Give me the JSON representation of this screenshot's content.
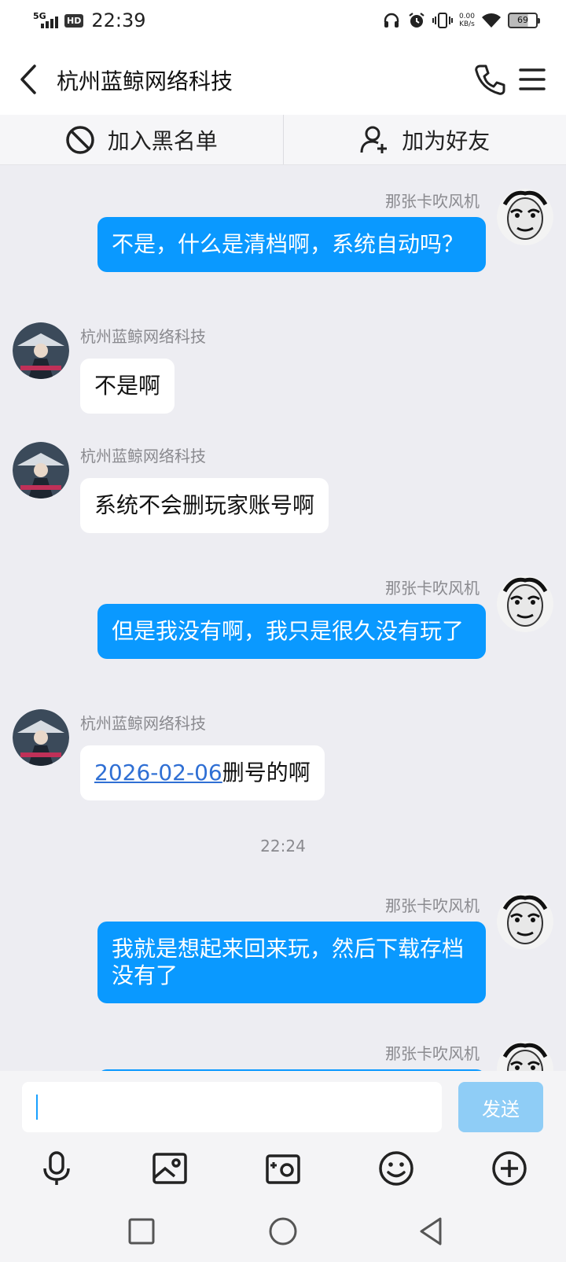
{
  "status_bar": {
    "network": "5G",
    "hd_badge": "HD",
    "time": "22:39",
    "speed_value": "0.00",
    "speed_unit": "KB/s",
    "battery_level": "69"
  },
  "header": {
    "title": "杭州蓝鲸网络科技"
  },
  "action_bar": {
    "block_label": "加入黑名单",
    "add_friend_label": "加为好友"
  },
  "messages": [
    {
      "sender": "那张卡吹风机",
      "text": "不是，什么是清档啊，系统自动吗？"
    },
    {
      "sender": "杭州蓝鲸网络科技",
      "text": "不是啊"
    },
    {
      "sender": "杭州蓝鲸网络科技",
      "text": "系统不会删玩家账号啊"
    },
    {
      "sender": "那张卡吹风机",
      "text": "但是我没有啊，我只是很久没有玩了"
    },
    {
      "sender": "杭州蓝鲸网络科技",
      "date_link": "2026-02-06",
      "text": "删号的啊"
    },
    {
      "sender": "那张卡吹风机",
      "text": "我就是想起来回来玩，然后下载存档没有了"
    },
    {
      "sender": "那张卡吹风机",
      "text": ""
    }
  ],
  "time_separator": "22:24",
  "composer": {
    "input_value": "",
    "send_label": "发送"
  },
  "toolbar": {
    "icons": [
      "microphone-icon",
      "image-icon",
      "camera-icon",
      "emoji-icon",
      "plus-icon"
    ]
  },
  "colors": {
    "self_bubble": "#0a99ff",
    "send_button_disabled": "#8fcdf6",
    "background": "#ededf2"
  }
}
